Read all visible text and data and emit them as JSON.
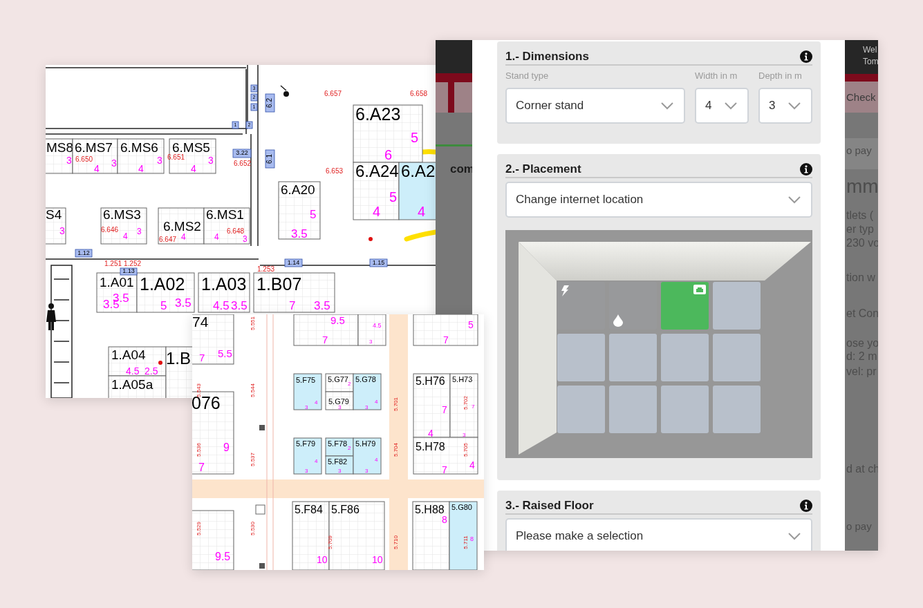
{
  "floor_plan_1": {
    "booths": [
      {
        "label": "MS8",
        "highlighted": false,
        "figures": [
          "3"
        ]
      },
      {
        "label": "6.MS7",
        "highlighted": false,
        "figures": [
          "3",
          "4"
        ]
      },
      {
        "label": "6.MS6",
        "highlighted": false,
        "figures": [
          "3",
          "4"
        ]
      },
      {
        "label": "6.MS5",
        "highlighted": false,
        "figures": [
          "3",
          "4"
        ]
      },
      {
        "label": "S4",
        "highlighted": false,
        "figures": [
          "3"
        ]
      },
      {
        "label": "6.MS3",
        "highlighted": false,
        "figures": [
          "4",
          "3"
        ]
      },
      {
        "label": "6.MS2",
        "highlighted": false,
        "figures": [
          "4"
        ]
      },
      {
        "label": "6.MS1",
        "highlighted": false,
        "figures": [
          "4",
          "3"
        ]
      },
      {
        "label": "6.A20",
        "highlighted": false,
        "figures": [
          "5",
          "3.5"
        ]
      },
      {
        "label": "6.A23",
        "highlighted": false,
        "figures": [
          "5",
          "6"
        ]
      },
      {
        "label": "6.A24",
        "highlighted": false,
        "figures": [
          "5",
          "4"
        ]
      },
      {
        "label": "6.A2",
        "highlighted": true,
        "figures": [
          "4"
        ]
      },
      {
        "label": "1.A01",
        "highlighted": false,
        "figures": [
          "3.5",
          "3.5"
        ]
      },
      {
        "label": "1.A02",
        "highlighted": false,
        "figures": [
          "5",
          "3.5"
        ]
      },
      {
        "label": "1.A03",
        "highlighted": false,
        "figures": [
          "4.5",
          "3.5"
        ]
      },
      {
        "label": "1.B07",
        "highlighted": false,
        "figures": [
          "7",
          "3.5"
        ]
      },
      {
        "label": "1.A04",
        "highlighted": false,
        "figures": [
          "4.5",
          "2.5"
        ]
      },
      {
        "label": "1.A05a",
        "highlighted": false
      },
      {
        "label": "1.B",
        "highlighted": false
      }
    ],
    "codes": [
      "6.657",
      "6.658",
      "6.650",
      "6.651",
      "6.652",
      "6.653",
      "6.646",
      "6.647",
      "6.648",
      "1.251",
      "1.252",
      "1.253"
    ],
    "tags": [
      "3",
      "2",
      "1",
      "1",
      "2",
      "6.2",
      "6.1",
      "3.22",
      "1.12",
      "1.13",
      "1.14",
      "1.15"
    ]
  },
  "floor_plan_2": {
    "booths": [
      {
        "label": "74",
        "highlighted": false,
        "figures": [
          "7",
          "5.5"
        ]
      },
      {
        "highlighted": false,
        "figures": [
          "9.5",
          "7"
        ]
      },
      {
        "highlighted": false,
        "figures": [
          "4.5",
          "3"
        ]
      },
      {
        "highlighted": false,
        "figures": [
          "5",
          "7"
        ]
      },
      {
        "label": "076",
        "highlighted": false,
        "figures": [
          "9",
          "7"
        ]
      },
      {
        "label": "5.F75",
        "highlighted": true,
        "figures": [
          "4",
          "3"
        ]
      },
      {
        "label": "5.G77",
        "highlighted": false,
        "figures": [
          "2"
        ]
      },
      {
        "label": "5.G79",
        "highlighted": false,
        "figures": [
          "3"
        ]
      },
      {
        "label": "5.G78",
        "highlighted": true,
        "figures": [
          "4",
          "3"
        ]
      },
      {
        "label": "5.F79",
        "highlighted": true,
        "figures": [
          "4",
          "3"
        ]
      },
      {
        "label": "5.F78",
        "highlighted": true,
        "figures": [
          "2"
        ]
      },
      {
        "label": "5.F82",
        "highlighted": true,
        "figures": [
          "3"
        ]
      },
      {
        "label": "5.H79",
        "highlighted": true,
        "figures": [
          "4",
          "3"
        ]
      },
      {
        "label": "5.H76",
        "highlighted": false,
        "figures": [
          "7",
          "4"
        ]
      },
      {
        "label": "5.H73",
        "highlighted": false,
        "figures": [
          "7",
          "3"
        ]
      },
      {
        "label": "5.H78",
        "highlighted": false,
        "figures": [
          "7",
          "4"
        ]
      },
      {
        "label": "5.F84",
        "highlighted": false,
        "figures": [
          "10"
        ]
      },
      {
        "label": "5.F86",
        "highlighted": false,
        "figures": [
          "10"
        ]
      },
      {
        "label": "5.H88",
        "highlighted": false,
        "figures": [
          "8"
        ]
      },
      {
        "label": "5.G80",
        "highlighted": true,
        "figures": [
          "8"
        ]
      },
      {
        "highlighted": false,
        "figures": [
          "9.5"
        ]
      }
    ],
    "codes": [
      "5.551",
      "5.543",
      "5.544",
      "5.536",
      "5.537",
      "5.529",
      "5.530",
      "5.701",
      "5.704",
      "5.710",
      "5.702",
      "5.705",
      "5.709",
      "5.711"
    ]
  },
  "backdrop": {
    "header_texts": [
      "Wel",
      "Tom"
    ],
    "tab_text": "Check",
    "heading_fragment": "com",
    "side_texts": [
      "o pay",
      "mm",
      "tlets (",
      "er typ",
      "230 vo",
      "tion w",
      "et Con",
      "ose yo",
      "d: 2 m",
      "vel: pr",
      "d at ch",
      "o pay"
    ]
  },
  "modal": {
    "sections": [
      {
        "title": "1.- Dimensions",
        "fields": [
          {
            "label": "Stand type",
            "value": "Corner stand"
          },
          {
            "label": "Width in m",
            "value": "4"
          },
          {
            "label": "Depth in m",
            "value": "3"
          }
        ]
      },
      {
        "title": "2.- Placement",
        "fields": [
          {
            "value": "Change internet location"
          }
        ],
        "tiles": [
          {
            "kind": "power",
            "selected": false
          },
          {
            "kind": "water",
            "selected": false
          },
          {
            "kind": "network",
            "selected": true
          },
          {
            "kind": "free",
            "selected": false
          },
          {
            "kind": "free",
            "selected": false
          },
          {
            "kind": "free",
            "selected": false
          },
          {
            "kind": "free",
            "selected": false
          },
          {
            "kind": "free",
            "selected": false
          },
          {
            "kind": "free",
            "selected": false
          },
          {
            "kind": "free",
            "selected": false
          },
          {
            "kind": "free",
            "selected": false
          },
          {
            "kind": "free",
            "selected": false
          }
        ]
      },
      {
        "title": "3.- Raised Floor",
        "fields": [
          {
            "value": "Please make a selection"
          }
        ]
      }
    ]
  }
}
